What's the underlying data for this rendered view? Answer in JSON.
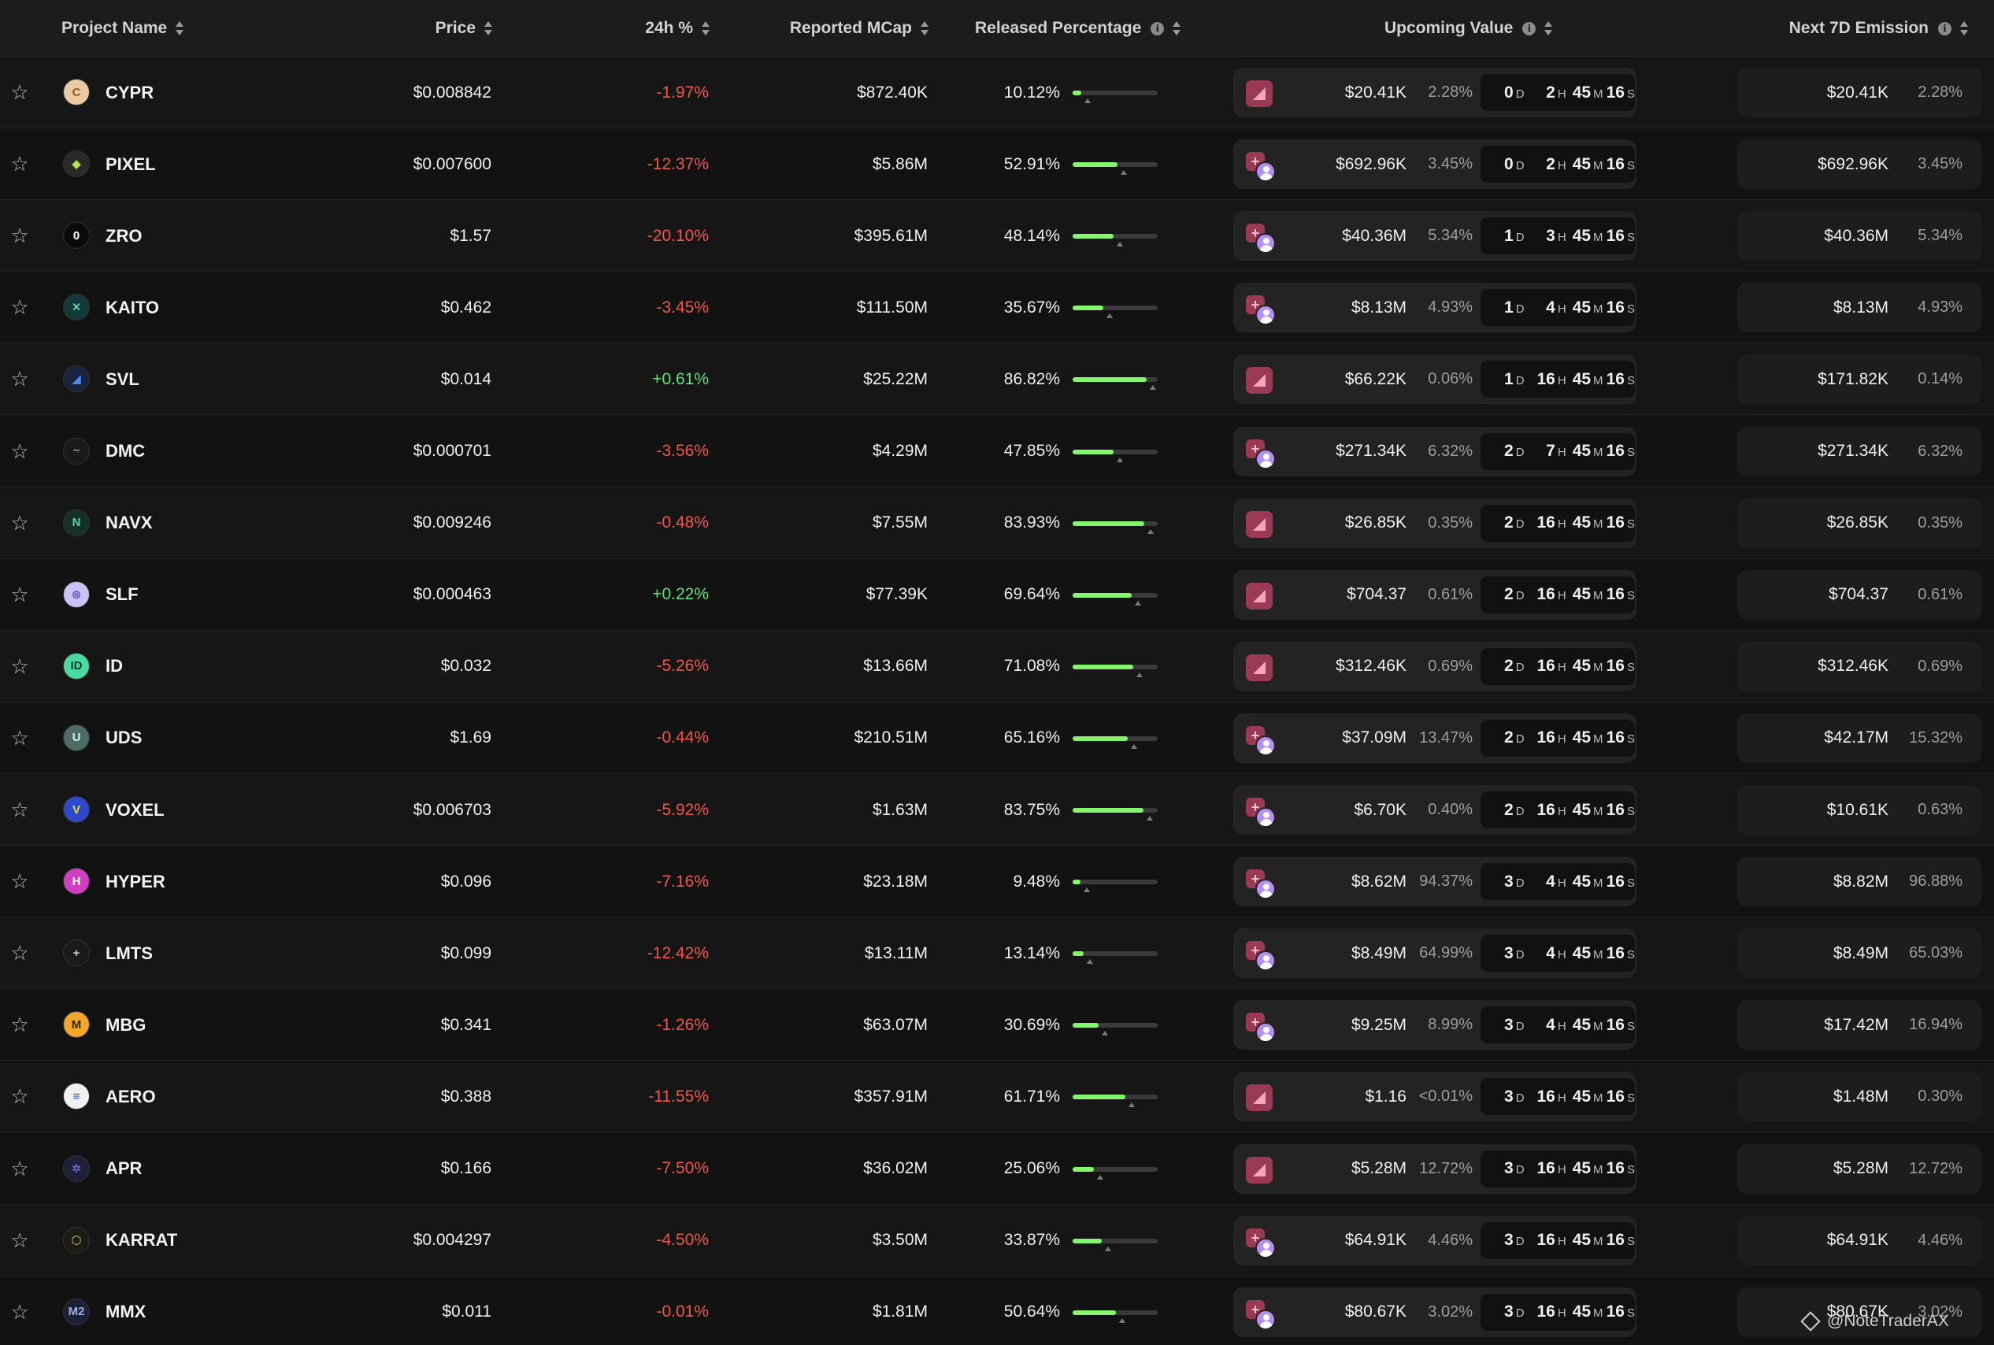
{
  "header": {
    "project_name": "Project Name",
    "price": "Price",
    "change": "24h %",
    "mcap": "Reported MCap",
    "released": "Released Percentage",
    "upcoming": "Upcoming Value",
    "next7d": "Next 7D Emission"
  },
  "icons": {
    "star": "star-outline-icon",
    "sort": "sort-arrows-icon",
    "info": "info-icon",
    "unlock_cliff": "cliff-unlock-icon",
    "unlock_team": "team-allocation-icon"
  },
  "colors": {
    "negative": "#f0564a",
    "positive": "#5fe07a",
    "bar": "#86f56e"
  },
  "countdown_units": {
    "d": "D",
    "h": "H",
    "m": "M",
    "s": "S"
  },
  "rows": [
    {
      "name": "CYPR",
      "price": "$0.008842",
      "change": "-1.97%",
      "dir": "neg",
      "mcap": "$872.40K",
      "released": "10.12%",
      "released_frac": 0.1012,
      "up_icon": "cliff",
      "up_val": "$20.41K",
      "up_pct": "2.28%",
      "cd_d": "0",
      "cd_h": "2",
      "cd_m": "45",
      "cd_s": "16",
      "ne_val": "$20.41K",
      "ne_pct": "2.28%",
      "logo_bg": "#e8c9a0",
      "logo_fg": "#8a5a20",
      "logo_txt": "C"
    },
    {
      "name": "PIXEL",
      "price": "$0.007600",
      "change": "-12.37%",
      "dir": "neg",
      "mcap": "$5.86M",
      "released": "52.91%",
      "released_frac": 0.5291,
      "up_icon": "team",
      "up_val": "$692.96K",
      "up_pct": "3.45%",
      "cd_d": "0",
      "cd_h": "2",
      "cd_m": "45",
      "cd_s": "16",
      "ne_val": "$692.96K",
      "ne_pct": "3.45%",
      "logo_bg": "#2a2a2a",
      "logo_fg": "#b6e34a",
      "logo_txt": "◆"
    },
    {
      "name": "ZRO",
      "price": "$1.57",
      "change": "-20.10%",
      "dir": "neg",
      "mcap": "$395.61M",
      "released": "48.14%",
      "released_frac": 0.4814,
      "up_icon": "team",
      "up_val": "$40.36M",
      "up_pct": "5.34%",
      "cd_d": "1",
      "cd_h": "3",
      "cd_m": "45",
      "cd_s": "16",
      "ne_val": "$40.36M",
      "ne_pct": "5.34%",
      "logo_bg": "#0a0a0a",
      "logo_fg": "#ffffff",
      "logo_txt": "0"
    },
    {
      "name": "KAITO",
      "price": "$0.462",
      "change": "-3.45%",
      "dir": "neg",
      "mcap": "$111.50M",
      "released": "35.67%",
      "released_frac": 0.3567,
      "up_icon": "team",
      "up_val": "$8.13M",
      "up_pct": "4.93%",
      "cd_d": "1",
      "cd_h": "4",
      "cd_m": "45",
      "cd_s": "16",
      "ne_val": "$8.13M",
      "ne_pct": "4.93%",
      "logo_bg": "#123b37",
      "logo_fg": "#6ef0d8",
      "logo_txt": "✕"
    },
    {
      "name": "SVL",
      "price": "$0.014",
      "change": "+0.61%",
      "dir": "pos",
      "mcap": "$25.22M",
      "released": "86.82%",
      "released_frac": 0.8682,
      "up_icon": "cliff",
      "up_val": "$66.22K",
      "up_pct": "0.06%",
      "cd_d": "1",
      "cd_h": "16",
      "cd_m": "45",
      "cd_s": "16",
      "ne_val": "$171.82K",
      "ne_pct": "0.14%",
      "logo_bg": "#1c2340",
      "logo_fg": "#4f8df5",
      "logo_txt": "◢"
    },
    {
      "name": "DMC",
      "price": "$0.000701",
      "change": "-3.56%",
      "dir": "neg",
      "mcap": "$4.29M",
      "released": "47.85%",
      "released_frac": 0.4785,
      "up_icon": "team",
      "up_val": "$271.34K",
      "up_pct": "6.32%",
      "cd_d": "2",
      "cd_h": "7",
      "cd_m": "45",
      "cd_s": "16",
      "ne_val": "$271.34K",
      "ne_pct": "6.32%",
      "logo_bg": "#1a1a1a",
      "logo_fg": "#9a9a9a",
      "logo_txt": "~"
    },
    {
      "name": "NAVX",
      "price": "$0.009246",
      "change": "-0.48%",
      "dir": "neg",
      "mcap": "$7.55M",
      "released": "83.93%",
      "released_frac": 0.8393,
      "up_icon": "cliff",
      "up_val": "$26.85K",
      "up_pct": "0.35%",
      "cd_d": "2",
      "cd_h": "16",
      "cd_m": "45",
      "cd_s": "16",
      "ne_val": "$26.85K",
      "ne_pct": "0.35%",
      "logo_bg": "#16302a",
      "logo_fg": "#5fd3a6",
      "logo_txt": "N"
    },
    {
      "name": "SLF",
      "price": "$0.000463",
      "change": "+0.22%",
      "dir": "pos",
      "mcap": "$77.39K",
      "released": "69.64%",
      "released_frac": 0.6964,
      "up_icon": "cliff",
      "up_val": "$704.37",
      "up_pct": "0.61%",
      "cd_d": "2",
      "cd_h": "16",
      "cd_m": "45",
      "cd_s": "16",
      "ne_val": "$704.37",
      "ne_pct": "0.61%",
      "logo_bg": "#c9c4f5",
      "logo_fg": "#5a4fd0",
      "logo_txt": "⊗"
    },
    {
      "name": "ID",
      "price": "$0.032",
      "change": "-5.26%",
      "dir": "neg",
      "mcap": "$13.66M",
      "released": "71.08%",
      "released_frac": 0.7108,
      "up_icon": "cliff",
      "up_val": "$312.46K",
      "up_pct": "0.69%",
      "cd_d": "2",
      "cd_h": "16",
      "cd_m": "45",
      "cd_s": "16",
      "ne_val": "$312.46K",
      "ne_pct": "0.69%",
      "logo_bg": "#4ad9a0",
      "logo_fg": "#0d3a2a",
      "logo_txt": "ID"
    },
    {
      "name": "UDS",
      "price": "$1.69",
      "change": "-0.44%",
      "dir": "neg",
      "mcap": "$210.51M",
      "released": "65.16%",
      "released_frac": 0.6516,
      "up_icon": "team",
      "up_val": "$37.09M",
      "up_pct": "13.47%",
      "cd_d": "2",
      "cd_h": "16",
      "cd_m": "45",
      "cd_s": "16",
      "ne_val": "$42.17M",
      "ne_pct": "15.32%",
      "logo_bg": "#4d6b66",
      "logo_fg": "#d8f0ea",
      "logo_txt": "U"
    },
    {
      "name": "VOXEL",
      "price": "$0.006703",
      "change": "-5.92%",
      "dir": "neg",
      "mcap": "$1.63M",
      "released": "83.75%",
      "released_frac": 0.8375,
      "up_icon": "team",
      "up_val": "$6.70K",
      "up_pct": "0.40%",
      "cd_d": "2",
      "cd_h": "16",
      "cd_m": "45",
      "cd_s": "16",
      "ne_val": "$10.61K",
      "ne_pct": "0.63%",
      "logo_bg": "#2e49c9",
      "logo_fg": "#f3d04a",
      "logo_txt": "V"
    },
    {
      "name": "HYPER",
      "price": "$0.096",
      "change": "-7.16%",
      "dir": "neg",
      "mcap": "$23.18M",
      "released": "9.48%",
      "released_frac": 0.0948,
      "up_icon": "team",
      "up_val": "$8.62M",
      "up_pct": "94.37%",
      "cd_d": "3",
      "cd_h": "4",
      "cd_m": "45",
      "cd_s": "16",
      "ne_val": "$8.82M",
      "ne_pct": "96.88%",
      "logo_bg": "#d23ec0",
      "logo_fg": "#ffffff",
      "logo_txt": "H"
    },
    {
      "name": "LMTS",
      "price": "$0.099",
      "change": "-12.42%",
      "dir": "neg",
      "mcap": "$13.11M",
      "released": "13.14%",
      "released_frac": 0.1314,
      "up_icon": "team",
      "up_val": "$8.49M",
      "up_pct": "64.99%",
      "cd_d": "3",
      "cd_h": "4",
      "cd_m": "45",
      "cd_s": "16",
      "ne_val": "$8.49M",
      "ne_pct": "65.03%",
      "logo_bg": "#1a1a1a",
      "logo_fg": "#cfcfcf",
      "logo_txt": "+"
    },
    {
      "name": "MBG",
      "price": "$0.341",
      "change": "-1.26%",
      "dir": "neg",
      "mcap": "$63.07M",
      "released": "30.69%",
      "released_frac": 0.3069,
      "up_icon": "team",
      "up_val": "$9.25M",
      "up_pct": "8.99%",
      "cd_d": "3",
      "cd_h": "4",
      "cd_m": "45",
      "cd_s": "16",
      "ne_val": "$17.42M",
      "ne_pct": "16.94%",
      "logo_bg": "#f2a62a",
      "logo_fg": "#3a2200",
      "logo_txt": "M"
    },
    {
      "name": "AERO",
      "price": "$0.388",
      "change": "-11.55%",
      "dir": "neg",
      "mcap": "$357.91M",
      "released": "61.71%",
      "released_frac": 0.6171,
      "up_icon": "cliff",
      "up_val": "$1.16",
      "up_pct": "<0.01%",
      "cd_d": "3",
      "cd_h": "16",
      "cd_m": "45",
      "cd_s": "16",
      "ne_val": "$1.48M",
      "ne_pct": "0.30%",
      "logo_bg": "#f0f0f0",
      "logo_fg": "#2a4fd0",
      "logo_txt": "≡"
    },
    {
      "name": "APR",
      "price": "$0.166",
      "change": "-7.50%",
      "dir": "neg",
      "mcap": "$36.02M",
      "released": "25.06%",
      "released_frac": 0.2506,
      "up_icon": "cliff",
      "up_val": "$5.28M",
      "up_pct": "12.72%",
      "cd_d": "3",
      "cd_h": "16",
      "cd_m": "45",
      "cd_s": "16",
      "ne_val": "$5.28M",
      "ne_pct": "12.72%",
      "logo_bg": "#1f1f3a",
      "logo_fg": "#7a7af0",
      "logo_txt": "✲"
    },
    {
      "name": "KARRAT",
      "price": "$0.004297",
      "change": "-4.50%",
      "dir": "neg",
      "mcap": "$3.50M",
      "released": "33.87%",
      "released_frac": 0.3387,
      "up_icon": "team",
      "up_val": "$64.91K",
      "up_pct": "4.46%",
      "cd_d": "3",
      "cd_h": "16",
      "cd_m": "45",
      "cd_s": "16",
      "ne_val": "$64.91K",
      "ne_pct": "4.46%",
      "logo_bg": "#1c1c14",
      "logo_fg": "#d8c46a",
      "logo_txt": "⬡"
    },
    {
      "name": "MMX",
      "price": "$0.011",
      "change": "-0.01%",
      "dir": "neg",
      "mcap": "$1.81M",
      "released": "50.64%",
      "released_frac": 0.5064,
      "up_icon": "team",
      "up_val": "$80.67K",
      "up_pct": "3.02%",
      "cd_d": "3",
      "cd_h": "16",
      "cd_m": "45",
      "cd_s": "16",
      "ne_val": "$80.67K",
      "ne_pct": "3.02%",
      "logo_bg": "#1b2236",
      "logo_fg": "#9fb4e8",
      "logo_txt": "M2"
    }
  ],
  "watermark": "@NoteTraderAX"
}
